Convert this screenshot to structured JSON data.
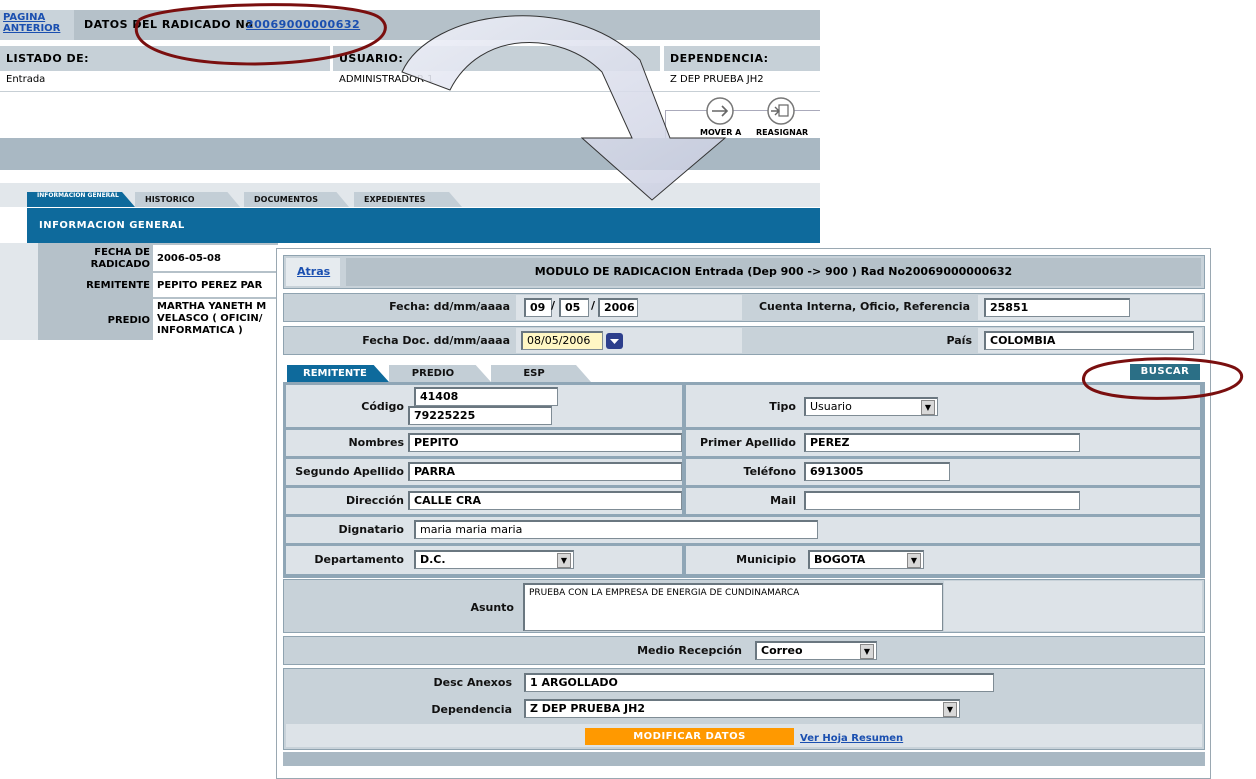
{
  "bg": {
    "back_link_line1": "PAGINA",
    "back_link_line2": "ANTERIOR",
    "radicado_label": "DATOS DEL RADICADO No",
    "radicado_number": "20069000000632",
    "listado_header": "LISTADO DE:",
    "usuario_header": "USUARIO:",
    "dependencia_header": "DEPENDENCIA:",
    "listado_value": "Entrada",
    "usuario_value": "ADMINISTRADOR 1",
    "dependencia_value": "Z DEP PRUEBA JH2",
    "mover_label": "MOVER A",
    "reasignar_label": "REASIGNAR",
    "tabs": [
      "INFORMACION GENERAL",
      "HISTORICO",
      "DOCUMENTOS",
      "EXPEDIENTES"
    ],
    "section_title": "INFORMACION GENERAL",
    "fecha_label_1": "FECHA DE",
    "fecha_label_2": "RADICADO",
    "fecha_value": "2006-05-08",
    "remitente_label": "REMITENTE",
    "remitente_value": "PEPITO PEREZ PAR",
    "predio_label": "PREDIO",
    "predio_value_1": "MARTHA YANETH M",
    "predio_value_2": "VELASCO ( OFICIN/",
    "predio_value_3": "INFORMATICA )"
  },
  "fw": {
    "atras": "Atras",
    "module_title": "MODULO DE RADICACION Entrada (Dep 900 -> 900 ) Rad No20069000000632",
    "fecha_label": "Fecha: dd/mm/aaaa",
    "fecha_day": "09",
    "fecha_month": "05",
    "fecha_year": "2006",
    "cuenta_label": "Cuenta Interna, Oficio, Referencia",
    "cuenta_value": "25851",
    "fecha_doc_label": "Fecha Doc. dd/mm/aaaa",
    "fecha_doc_value": "08/05/2006",
    "pais_label": "País",
    "pais_value": "COLOMBIA",
    "tabs": [
      "REMITENTE",
      "PREDIO",
      "ESP"
    ],
    "buscar": "BUSCAR",
    "codigo_label": "Código",
    "codigo_value_1": "41408",
    "codigo_value_2": "79225225",
    "tipo_label": "Tipo",
    "tipo_value": "Usuario",
    "nombres_label": "Nombres",
    "nombres_value": "PEPITO",
    "primer_apellido_label": "Primer Apellido",
    "primer_apellido_value": "PEREZ",
    "segundo_apellido_label": "Segundo Apellido",
    "segundo_apellido_value": "PARRA",
    "telefono_label": "Teléfono",
    "telefono_value": "6913005",
    "direccion_label": "Dirección",
    "direccion_value": "CALLE CRA",
    "mail_label": "Mail",
    "mail_value": "",
    "dignatario_label": "Dignatario",
    "dignatario_value": "maria maria maria",
    "departamento_label": "Departamento",
    "departamento_value": "D.C.",
    "municipio_label": "Municipio",
    "municipio_value": "BOGOTA",
    "asunto_label": "Asunto",
    "asunto_value": "PRUEBA CON LA EMPRESA DE ENERGIA DE CUNDINAMARCA",
    "medio_label": "Medio Recepción",
    "medio_value": "Correo",
    "anexos_label": "Desc Anexos",
    "anexos_value": "1 ARGOLLADO",
    "dependencia_label": "Dependencia",
    "dependencia_value": "Z DEP PRUEBA JH2",
    "modificar": "MODIFICAR DATOS",
    "ver_hoja": "Ver Hoja Resumen"
  },
  "colors": {
    "accent_blue": "#0e6a9c",
    "highlight_orange": "#ff9900",
    "annotation_red": "#7a0f0f",
    "date_input_bg": "#fff7c4"
  }
}
